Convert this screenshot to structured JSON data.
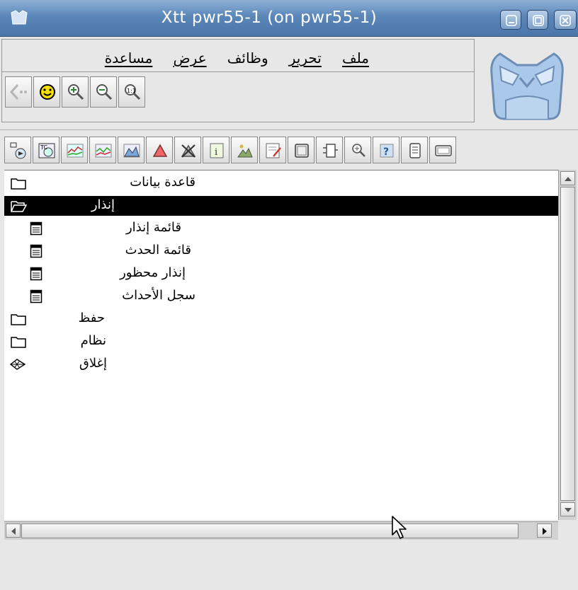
{
  "window": {
    "title": "Xtt pwr55-1 (on pwr55-1)"
  },
  "menu": [
    "ملف",
    "تحرير",
    "وظائف",
    "عرض",
    "مساعدة"
  ],
  "nav_buttons": [
    "back-icon",
    "smiley-icon",
    "zoom-in-icon",
    "zoom-out-icon",
    "zoom-reset-icon"
  ],
  "toolbar_icons": [
    "open-object-icon",
    "open-graph-icon",
    "trend-icon",
    "trend2-icon",
    "history-icon",
    "alarm-icon",
    "block-icon",
    "info-icon",
    "image-icon",
    "edit-icon",
    "object-icon",
    "plc-icon",
    "zoom-icon",
    "help-icon",
    "document-icon",
    "display-icon"
  ],
  "tree": {
    "items": [
      {
        "label": "قاعدة بيانات",
        "icon": "folder-icon",
        "level": 0,
        "selected": false
      },
      {
        "label": "إنذار",
        "icon": "folder-open-icon",
        "level": 0,
        "selected": true
      },
      {
        "label": "قائمة إنذار",
        "icon": "list-icon",
        "level": 1,
        "selected": false
      },
      {
        "label": "قائمة الحدث",
        "icon": "list-icon",
        "level": 1,
        "selected": false
      },
      {
        "label": "إنذار محظور",
        "icon": "list-icon",
        "level": 1,
        "selected": false
      },
      {
        "label": "سجل الأحداث",
        "icon": "list-icon",
        "level": 1,
        "selected": false
      },
      {
        "label": "حفظ",
        "icon": "folder-icon",
        "level": 0,
        "selected": false
      },
      {
        "label": "نظام",
        "icon": "folder-icon",
        "level": 0,
        "selected": false
      },
      {
        "label": "إغلاق",
        "icon": "leaf-icon",
        "level": 0,
        "selected": false
      }
    ]
  },
  "colors": {
    "titlebar": "#5a86b8",
    "selection": "#000000",
    "background": "#e7e7e7"
  }
}
